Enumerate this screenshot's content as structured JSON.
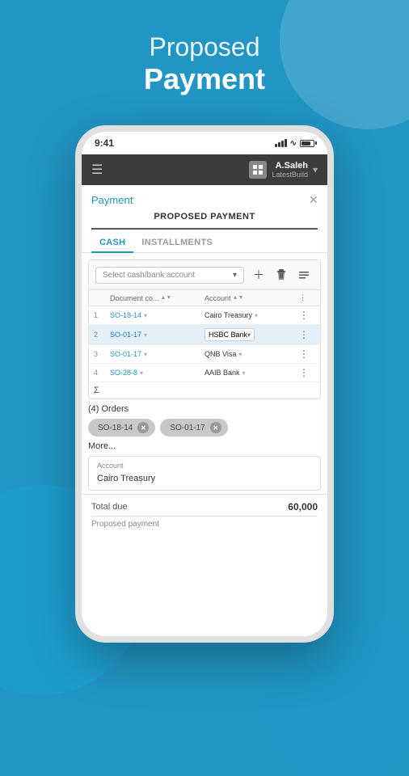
{
  "background": {
    "color": "#2196c4"
  },
  "header": {
    "line1": "Proposed",
    "line2": "Payment"
  },
  "phone": {
    "time": "9:41",
    "topbar": {
      "menu_icon": "☰",
      "user_name": "A.Saleh",
      "build_name": "LatestBuild",
      "arrow": "▾"
    },
    "content": {
      "payment_link": "Payment",
      "close_btn": "×",
      "section_title": "PROPOSED PAYMENT",
      "tabs": [
        {
          "label": "CASH",
          "active": true
        },
        {
          "label": "INSTALLMENTS",
          "active": false
        }
      ],
      "select_placeholder": "Select cash/bank account",
      "table": {
        "columns": [
          "Document co...",
          "Account"
        ],
        "rows": [
          {
            "num": "1",
            "doc": "SO-18-14",
            "account": "Cairo Treasury",
            "selected": false
          },
          {
            "num": "2",
            "doc": "SO-01-17",
            "account": "HSBC Bank",
            "selected": true
          },
          {
            "num": "3",
            "doc": "SO-01-17",
            "account": "QNB Visa",
            "selected": false
          },
          {
            "num": "4",
            "doc": "SO-28-8",
            "account": "AAIB Bank",
            "selected": false
          }
        ],
        "sigma": "Σ"
      },
      "orders": {
        "count_label": "(4) Orders",
        "chips": [
          {
            "label": "SO-18-14"
          },
          {
            "label": "SO-01-17"
          }
        ],
        "more_label": "More..."
      },
      "tooltip": {
        "label": "Account",
        "value": "Cairo Treasury"
      },
      "totals": {
        "due_label": "Total due",
        "due_value": "60,000",
        "proposed_label": "Proposed payment"
      }
    }
  }
}
